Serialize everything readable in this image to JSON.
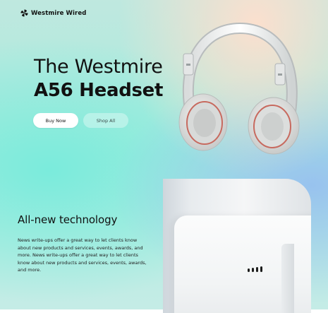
{
  "header": {
    "brand": "Westmire Wired",
    "logo_icon": "pinwheel-logo-icon"
  },
  "hero": {
    "title_line1": "The Westmire",
    "title_line2": "A56 Headset",
    "buy_label": "Buy Now",
    "shop_label": "Shop All",
    "image": "white-headphones-image"
  },
  "feature": {
    "title": "All-new technology",
    "body": "News write-ups offer a great way to let clients know about new products and services, events, awards, and more. News write-ups offer a great way to let clients know about new products and services, events, awards, and more.",
    "image": "white-device-closeup-image"
  },
  "colors": {
    "accent_mint": "#a6ecdd",
    "button_white": "#ffffff",
    "text_dark": "#111111"
  }
}
